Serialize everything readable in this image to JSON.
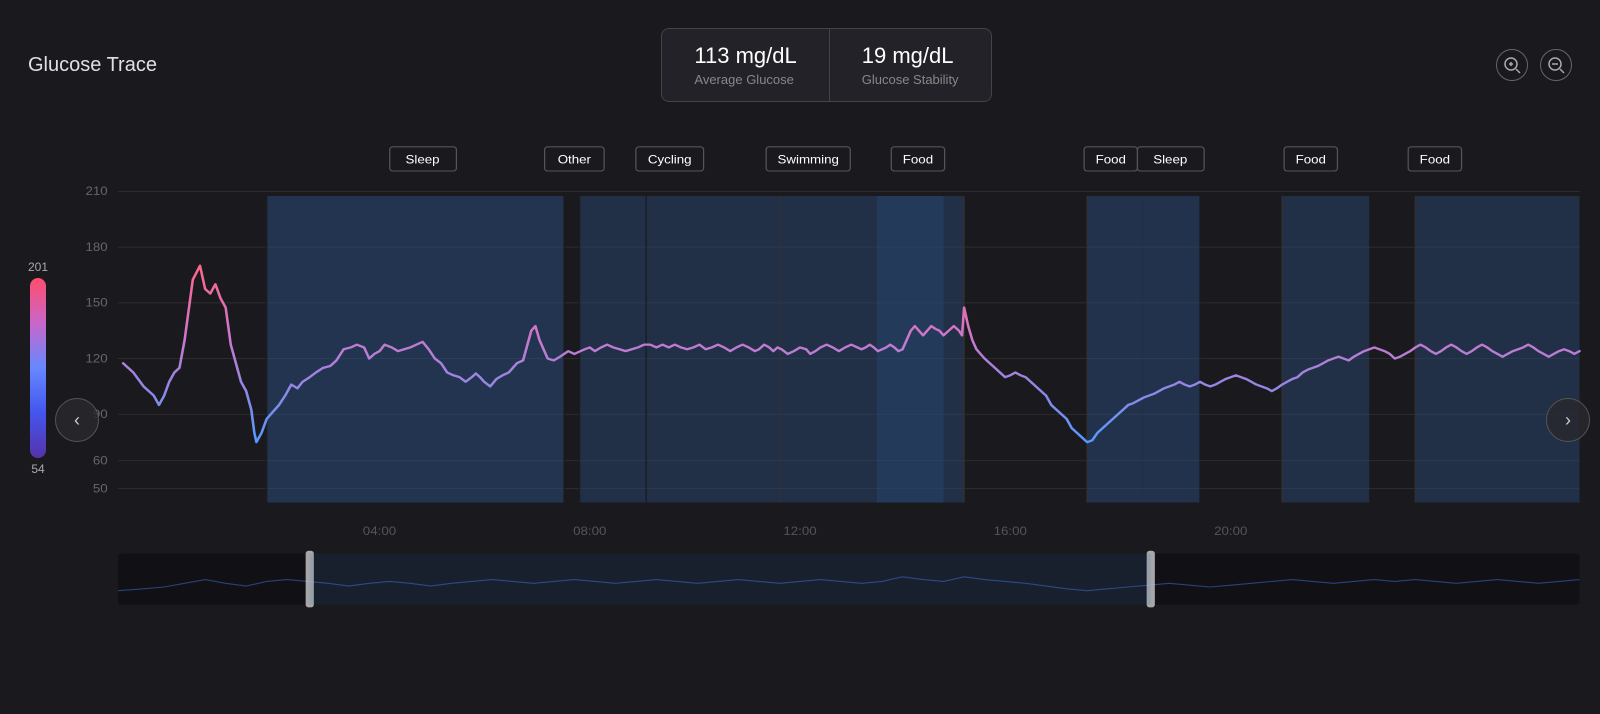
{
  "header": {
    "title": "Glucose Trace",
    "stats": [
      {
        "value": "113 mg/dL",
        "label": "Average Glucose"
      },
      {
        "value": "19 mg/dL",
        "label": "Glucose Stability"
      }
    ],
    "zoom_in": "+",
    "zoom_out": "−"
  },
  "color_scale": {
    "top_value": "201",
    "bottom_value": "54"
  },
  "time_labels": [
    "04:00",
    "08:00",
    "12:00",
    "16:00",
    "20:00"
  ],
  "y_labels": [
    "210",
    "180",
    "150",
    "120",
    "90",
    "60",
    "50"
  ],
  "events": [
    {
      "label": "Sleep",
      "x_pct": 21
    },
    {
      "label": "Other",
      "x_pct": 34
    },
    {
      "label": "Cycling",
      "x_pct": 40
    },
    {
      "label": "Swimming",
      "x_pct": 48
    },
    {
      "label": "Food",
      "x_pct": 56
    },
    {
      "label": "Food",
      "x_pct": 67
    },
    {
      "label": "Sleep",
      "x_pct": 70
    },
    {
      "label": "Food",
      "x_pct": 82
    },
    {
      "label": "Food",
      "x_pct": 90
    }
  ],
  "nav": {
    "prev": "‹",
    "next": "›"
  }
}
